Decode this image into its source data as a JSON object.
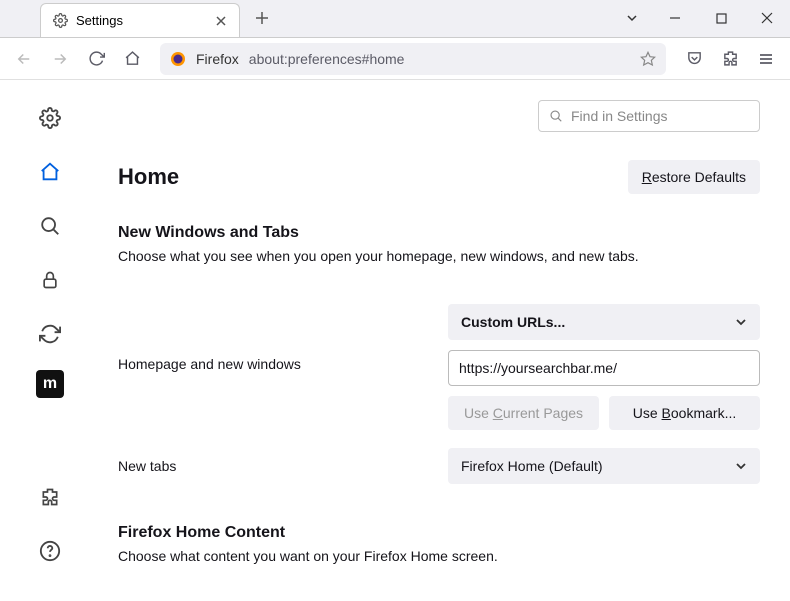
{
  "tab": {
    "title": "Settings"
  },
  "urlbar": {
    "brand": "Firefox",
    "url": "about:preferences#home"
  },
  "search": {
    "placeholder": "Find in Settings"
  },
  "page": {
    "title": "Home",
    "restore": "estore Defaults",
    "restore_u": "R"
  },
  "section1": {
    "title": "New Windows and Tabs",
    "desc": "Choose what you see when you open your homepage, new windows, and new tabs."
  },
  "homepage": {
    "label": "Homepage and new windows",
    "dropdown": "Custom URLs...",
    "url": "https://yoursearchbar.me/",
    "use_current_pre": "Use ",
    "use_current_u": "C",
    "use_current_post": "urrent Pages",
    "use_bookmark_pre": "Use ",
    "use_bookmark_u": "B",
    "use_bookmark_post": "ookmark..."
  },
  "newtabs": {
    "label": "New tabs",
    "value": "Firefox Home (Default)"
  },
  "section2": {
    "title": "Firefox Home Content",
    "desc": "Choose what content you want on your Firefox Home screen."
  }
}
